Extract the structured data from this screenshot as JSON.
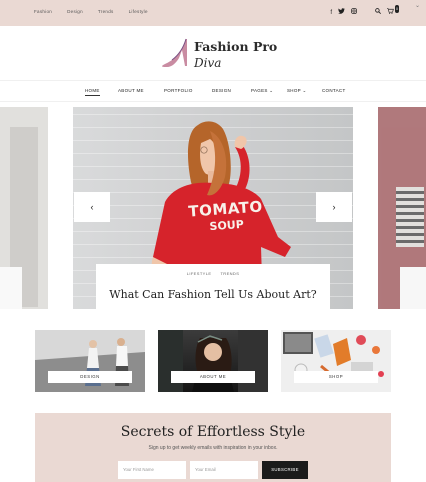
{
  "top_bar": {
    "nav": [
      "Fashion",
      "Design",
      "Trends",
      "Lifestyle"
    ],
    "icons": [
      "facebook-icon",
      "twitter-icon",
      "instagram-icon",
      "search-icon",
      "cart-icon"
    ],
    "cart_count": "0"
  },
  "logo": {
    "title": "Fashion Pro",
    "subtitle": "Diva"
  },
  "main_nav": {
    "items": [
      "HOME",
      "ABOUT ME",
      "PORTFOLIO",
      "DESIGN",
      "PAGES",
      "SHOP",
      "CONTACT"
    ],
    "active": "HOME"
  },
  "slider": {
    "category_1": "LIFESTYLE",
    "category_2": "TRENDS",
    "headline": "What Can Fashion Tell Us About Art?",
    "shirt_line1": "TOMATO",
    "shirt_line2": "SOUP"
  },
  "featured": [
    {
      "label": "DESIGN"
    },
    {
      "label": "ABOUT ME"
    },
    {
      "label": "SHOP"
    }
  ],
  "newsletter": {
    "heading": "Secrets of Effortless Style",
    "subtext": "Sign up to get weekly emails with inspiration in your inbox.",
    "first_name_placeholder": "Your First Name",
    "email_placeholder": "Your Email",
    "button": "SUBSCRIBE"
  },
  "colors": {
    "accent_pink": "#ead9d3",
    "dark": "#1b1b1b",
    "sweater_red": "#d6232b"
  }
}
